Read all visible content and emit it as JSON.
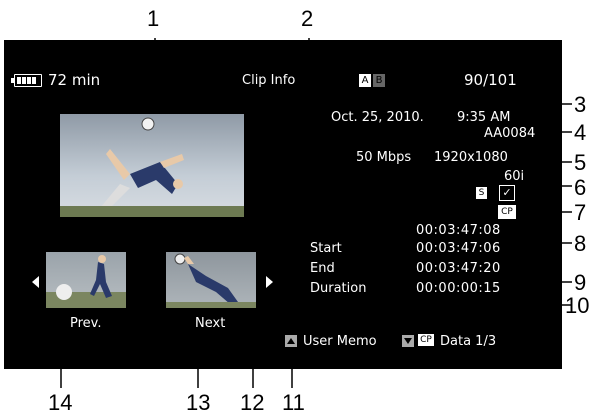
{
  "screen": {
    "battery": "72 min",
    "title": "Clip Info",
    "slot_a": "A",
    "slot_b": "B",
    "clip_counter": "90/101",
    "date": "Oct. 25, 2010.",
    "time": "9:35 AM",
    "clip_name": "AA0084",
    "bitrate": "50 Mbps",
    "resolution": "1920x1080",
    "frame_rate": "60i",
    "s_mark": "S",
    "check_mark": "✓",
    "cp_mark": "CP",
    "timecode": "00:03:47:08",
    "rows": [
      {
        "label": "Start",
        "value": "00:03:47:06"
      },
      {
        "label": "End",
        "value": "00:03:47:20"
      },
      {
        "label": "Duration",
        "value": "00:00:00:15"
      }
    ],
    "prev_label": "Prev.",
    "next_label": "Next",
    "footer_memo": "User Memo",
    "footer_cp": "CP",
    "footer_data": "Data 1/3"
  },
  "callouts": [
    "1",
    "2",
    "3",
    "4",
    "5",
    "6",
    "7",
    "8",
    "9",
    "10",
    "11",
    "12",
    "13",
    "14"
  ]
}
